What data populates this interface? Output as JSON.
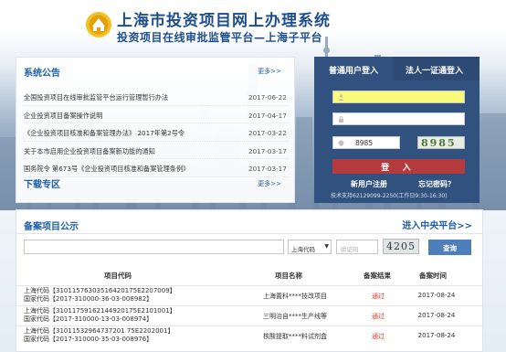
{
  "header": {
    "title": "上海市投资项目网上办理系统",
    "subtitle": "投资项目在线审批监管平台—上海子平台"
  },
  "notice": {
    "title": "系统公告",
    "more": "更多>>",
    "items": [
      {
        "title": "全国投资项目在线审批监管平台运行管理暂行办法",
        "date": "2017-06-22"
      },
      {
        "title": "企业投资项目备案操作说明",
        "date": "2017-04-17"
      },
      {
        "title": "《企业投资项目核准和备案管理办法》 2017年第2号令",
        "date": "2017-03-22"
      },
      {
        "title": "关于本市启用企业投资项目备案新功能的通知",
        "date": "2017-03-17"
      },
      {
        "title": "国务院令 第673号《企业投资项目核准和备案管理条例》",
        "date": "2017-03-17"
      }
    ],
    "download_title": "下载专区",
    "download_more": "更多>>"
  },
  "login": {
    "tab_normal": "普通用户登入",
    "tab_cert": "法人一证通登入",
    "captcha_value": "8985",
    "captcha_image_text": "8985",
    "login_button": "登 入",
    "register": "新用户注册",
    "forgot": "忘记密码？",
    "support": "技术支持62129099-2250(工作日9:30-16:30)"
  },
  "filing": {
    "title": "备案项目公示",
    "central_link": "进入中央平台>>",
    "search": {
      "query_value": "",
      "select_value": "上海代码",
      "code_placeholder": "验证码",
      "captcha_text": "4205",
      "button": "查询"
    },
    "columns": [
      "项目代码",
      "项目名称",
      "备案结果",
      "备案时间"
    ],
    "rows": [
      {
        "code1": "上海代码【31011576303516420175E2207009】",
        "code2": "国家代码【2017-310000-36-03-008982】",
        "name": "上海置科****技改项目",
        "result": "通过",
        "date": "2017-08-24"
      },
      {
        "code1": "上海代码【31011759162144920175E2101001】",
        "code2": "国家代码【2017-310000-13-03-008974】",
        "name": "三明治自****生产线等",
        "result": "通过",
        "date": "2017-08-24"
      },
      {
        "code1": "上海代码【31011532964737201 75E2202001】",
        "code2": "国家代码【2017-310000-35-03-008976】",
        "name": "核酸提取****料试剂盒",
        "result": "通过",
        "date": "2017-08-24"
      }
    ]
  },
  "colors": {
    "brand_blue": "#1e4f8c",
    "login_panel": "#31527e",
    "login_button": "#b53a3d",
    "user_field": "#fafa7a",
    "result_pass": "#e23b2a",
    "query_button": "#4f7fb8"
  },
  "icons": {
    "logo": "emblem-logo",
    "user": "user-icon",
    "password": "lock-icon",
    "captcha": "shield-icon"
  }
}
